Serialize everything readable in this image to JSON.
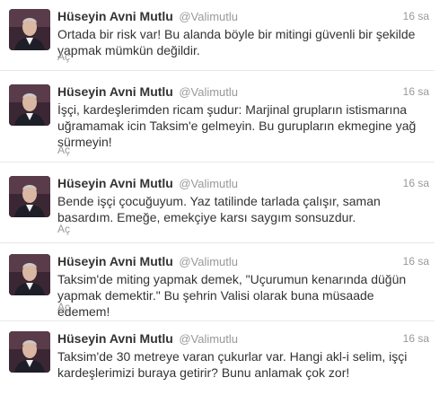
{
  "tweets": [
    {
      "name": "Hüseyin Avni Mutlu",
      "handle": "@Valimutlu",
      "time": "16 sa",
      "text": "Ortada bir risk var! Bu alanda böyle bir mitingi güvenli bir şekilde yapmak mümkün değildir.",
      "expand": "Aç"
    },
    {
      "name": "Hüseyin Avni Mutlu",
      "handle": "@Valimutlu",
      "time": "16 sa",
      "text": "İşçi, kardeşlerimden ricam şudur: Marjinal grupların istismarına uğramamak icin Taksim'e gelmeyin. Bu gurupların ekmegine yağ sürmeyin!",
      "expand": "Aç"
    },
    {
      "name": "Hüseyin Avni Mutlu",
      "handle": "@Valimutlu",
      "time": "16 sa",
      "text": "Bende işçi çocuğuyum. Yaz tatilinde tarlada çalışır, saman basardım. Emeğe, emekçiye karsı saygım sonsuzdur.",
      "expand": "Aç"
    },
    {
      "name": "Hüseyin Avni Mutlu",
      "handle": "@Valimutlu",
      "time": "16 sa",
      "text": "Taksim'de miting yapmak demek, \"Uçurumun kenarında düğün yapmak demektir.\" Bu şehrin Valisi olarak buna müsaade edemem!",
      "expand": "Aç"
    },
    {
      "name": "Hüseyin Avni Mutlu",
      "handle": "@Valimutlu",
      "time": "16 sa",
      "text": "Taksim'de 30 metreye varan çukurlar var. Hangi akl-i selim, işçi kardeşlerimizi buraya getirir? Bunu anlamak çok zor!",
      "expand": ""
    }
  ]
}
